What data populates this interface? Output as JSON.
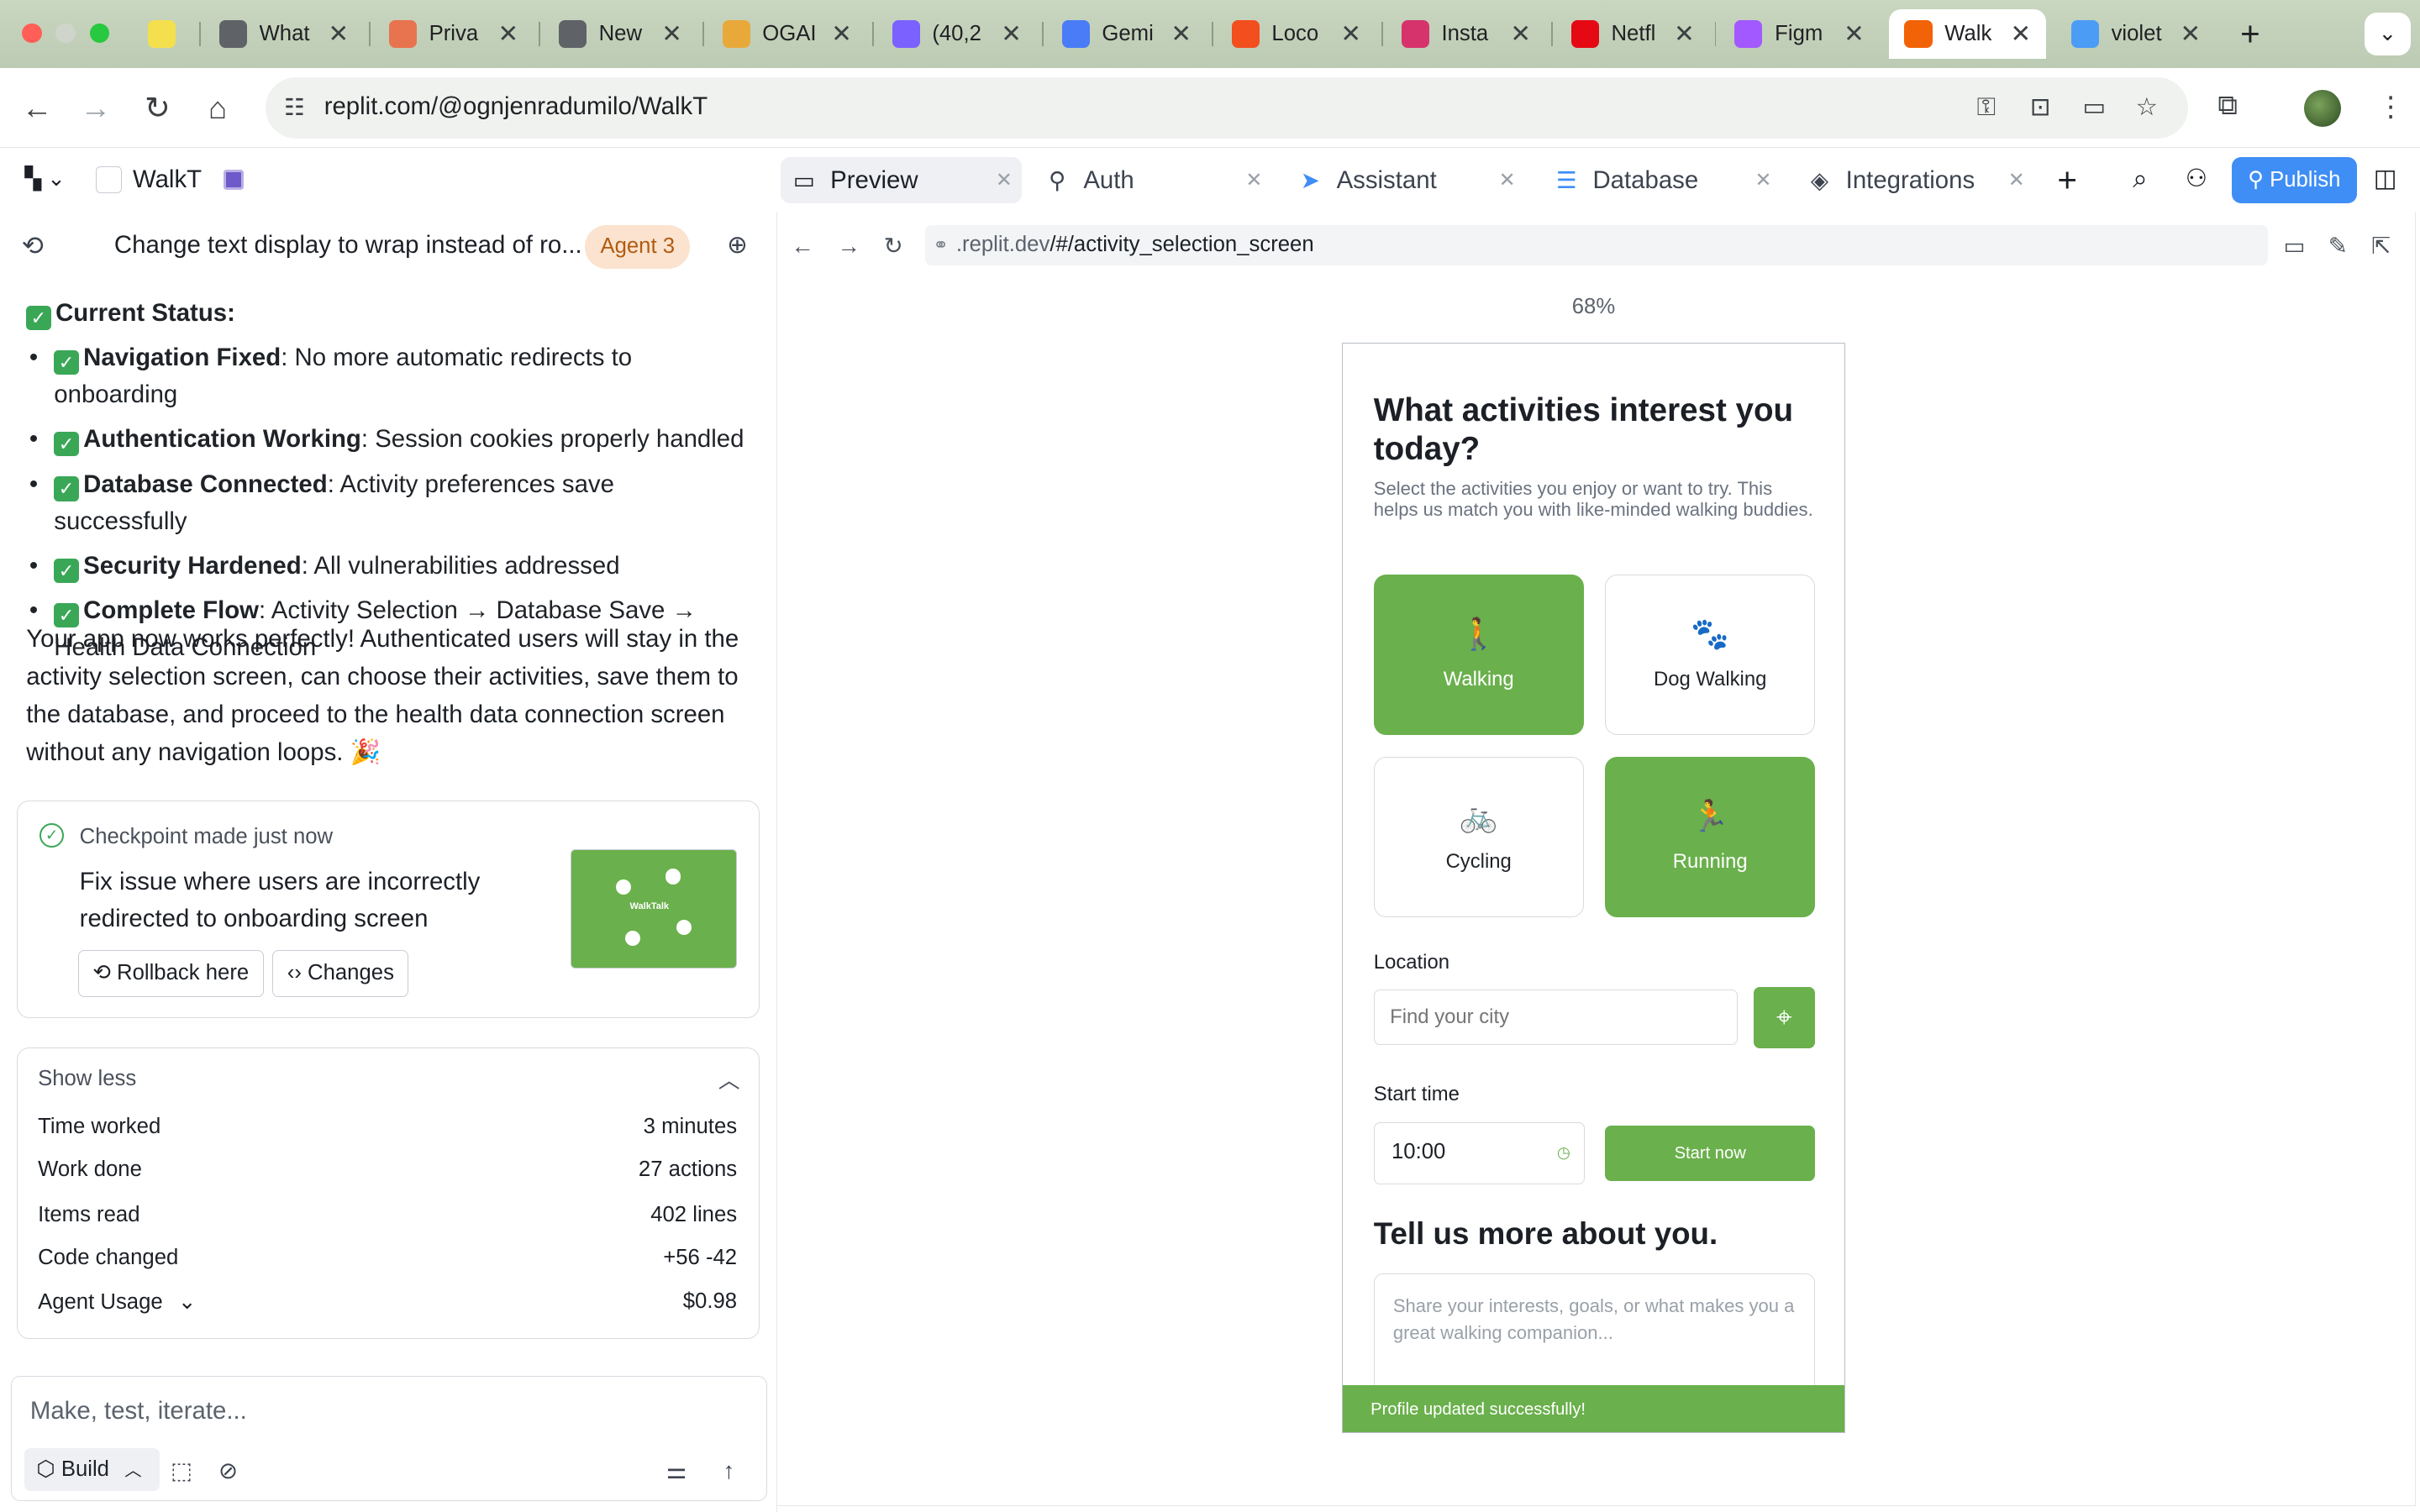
{
  "browser": {
    "tabs": [
      {
        "label": "",
        "color": "#f4e04d"
      },
      {
        "label": "What",
        "color": "#5f6368"
      },
      {
        "label": "Priva",
        "color": "#e8744f"
      },
      {
        "label": "New",
        "color": "#5f6368"
      },
      {
        "label": "OGAI",
        "color": "#e8a93a"
      },
      {
        "label": "(40,2",
        "color": "#7b61ff"
      },
      {
        "label": "Gemi",
        "color": "#4a7cf7"
      },
      {
        "label": "Loco",
        "color": "#f24e1e"
      },
      {
        "label": "Insta",
        "color": "#d6336c"
      },
      {
        "label": "Netfl",
        "color": "#e50914"
      },
      {
        "label": "Figm",
        "color": "#a259ff"
      },
      {
        "label": "Walk",
        "color": "#f26207"
      },
      {
        "label": "violet",
        "color": "#4b9cf5"
      }
    ],
    "url": "replit.com/@ognjenradumilo/WalkT"
  },
  "workspace": {
    "project_name": "WalkT",
    "tabs": [
      {
        "label": "Preview",
        "icon": "monitor-icon"
      },
      {
        "label": "Auth",
        "icon": "user-check-icon"
      },
      {
        "label": "Assistant",
        "icon": "assistant-icon"
      },
      {
        "label": "Database",
        "icon": "database-icon"
      },
      {
        "label": "Integrations",
        "icon": "layers-icon"
      }
    ],
    "publish_label": "Publish"
  },
  "chat": {
    "title": "Change text display to wrap instead of ro...",
    "agent_badge": "Agent 3",
    "status_title": "Current Status:",
    "bullets": [
      {
        "bold": "Navigation Fixed",
        "text": ": No more automatic redirects to onboarding"
      },
      {
        "bold": "Authentication Working",
        "text": ": Session cookies properly handled"
      },
      {
        "bold": "Database Connected",
        "text": ": Activity preferences save successfully"
      },
      {
        "bold": "Security Hardened",
        "text": ": All vulnerabilities addressed"
      },
      {
        "bold": "Complete Flow",
        "text": ": Activity Selection → Database Save → Health Data Connection"
      }
    ],
    "summary": "Your app now works perfectly! Authenticated users will stay in the activity selection screen, can choose their activities, save them to the database, and proceed to the health data connection screen without any navigation loops. 🎉",
    "checkpoint": {
      "made": "Checkpoint made just now",
      "description": "Fix issue where users are incorrectly redirected to onboarding screen",
      "rollback_label": "Rollback here",
      "changes_label": "Changes",
      "thumb_text": "WalkTalk"
    },
    "stats": {
      "toggle_label": "Show less",
      "rows": [
        {
          "k": "Time worked",
          "v": "3 minutes"
        },
        {
          "k": "Work done",
          "v": "27 actions"
        },
        {
          "k": "Items read",
          "v": "402 lines"
        },
        {
          "k": "Code changed",
          "v": "+56 -42"
        },
        {
          "k": "Agent Usage",
          "v": "$0.98"
        }
      ]
    },
    "composer": {
      "placeholder": "Make, test, iterate...",
      "mode_label": "Build"
    }
  },
  "preview": {
    "url_host": ".replit.dev",
    "url_path": "/#/activity_selection_screen",
    "progress": "68%",
    "app": {
      "title": "What activities interest you today?",
      "subtitle": "Select the activities you enjoy or want to try. This helps us match you with like-minded walking buddies.",
      "activities": [
        {
          "label": "Walking",
          "selected": true,
          "icon": "walking-icon"
        },
        {
          "label": "Dog Walking",
          "selected": false,
          "icon": "paw-icon"
        },
        {
          "label": "Cycling",
          "selected": false,
          "icon": "bicycle-icon"
        },
        {
          "label": "Running",
          "selected": true,
          "icon": "running-icon"
        }
      ],
      "location_label": "Location",
      "city_placeholder": "Find your city",
      "start_time_label": "Start time",
      "time_value": "10:00",
      "start_now_label": "Start now",
      "about_title": "Tell us more about you.",
      "about_placeholder": "Share your interests, goals, or what makes you a great walking companion...",
      "toast": "Profile updated successfully!"
    },
    "accent_color": "#6ab04c"
  }
}
